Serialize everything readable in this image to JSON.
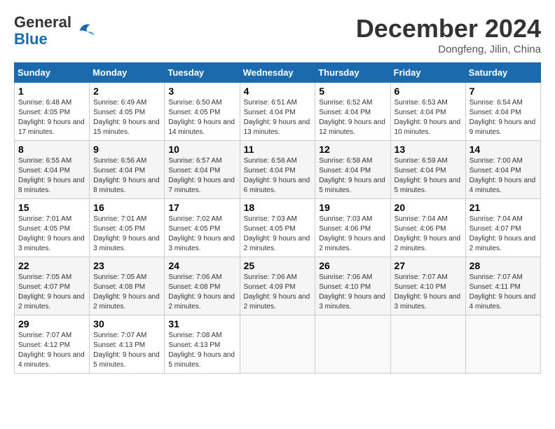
{
  "header": {
    "logo_general": "General",
    "logo_blue": "Blue",
    "month_title": "December 2024",
    "location": "Dongfeng, Jilin, China"
  },
  "days_of_week": [
    "Sunday",
    "Monday",
    "Tuesday",
    "Wednesday",
    "Thursday",
    "Friday",
    "Saturday"
  ],
  "weeks": [
    [
      {
        "day": "1",
        "sunrise": "6:48 AM",
        "sunset": "4:05 PM",
        "daylight": "9 hours and 17 minutes."
      },
      {
        "day": "2",
        "sunrise": "6:49 AM",
        "sunset": "4:05 PM",
        "daylight": "9 hours and 15 minutes."
      },
      {
        "day": "3",
        "sunrise": "6:50 AM",
        "sunset": "4:05 PM",
        "daylight": "9 hours and 14 minutes."
      },
      {
        "day": "4",
        "sunrise": "6:51 AM",
        "sunset": "4:04 PM",
        "daylight": "9 hours and 13 minutes."
      },
      {
        "day": "5",
        "sunrise": "6:52 AM",
        "sunset": "4:04 PM",
        "daylight": "9 hours and 12 minutes."
      },
      {
        "day": "6",
        "sunrise": "6:53 AM",
        "sunset": "4:04 PM",
        "daylight": "9 hours and 10 minutes."
      },
      {
        "day": "7",
        "sunrise": "6:54 AM",
        "sunset": "4:04 PM",
        "daylight": "9 hours and 9 minutes."
      }
    ],
    [
      {
        "day": "8",
        "sunrise": "6:55 AM",
        "sunset": "4:04 PM",
        "daylight": "9 hours and 8 minutes."
      },
      {
        "day": "9",
        "sunrise": "6:56 AM",
        "sunset": "4:04 PM",
        "daylight": "9 hours and 8 minutes."
      },
      {
        "day": "10",
        "sunrise": "6:57 AM",
        "sunset": "4:04 PM",
        "daylight": "9 hours and 7 minutes."
      },
      {
        "day": "11",
        "sunrise": "6:58 AM",
        "sunset": "4:04 PM",
        "daylight": "9 hours and 6 minutes."
      },
      {
        "day": "12",
        "sunrise": "6:58 AM",
        "sunset": "4:04 PM",
        "daylight": "9 hours and 5 minutes."
      },
      {
        "day": "13",
        "sunrise": "6:59 AM",
        "sunset": "4:04 PM",
        "daylight": "9 hours and 5 minutes."
      },
      {
        "day": "14",
        "sunrise": "7:00 AM",
        "sunset": "4:04 PM",
        "daylight": "9 hours and 4 minutes."
      }
    ],
    [
      {
        "day": "15",
        "sunrise": "7:01 AM",
        "sunset": "4:05 PM",
        "daylight": "9 hours and 3 minutes."
      },
      {
        "day": "16",
        "sunrise": "7:01 AM",
        "sunset": "4:05 PM",
        "daylight": "9 hours and 3 minutes."
      },
      {
        "day": "17",
        "sunrise": "7:02 AM",
        "sunset": "4:05 PM",
        "daylight": "9 hours and 3 minutes."
      },
      {
        "day": "18",
        "sunrise": "7:03 AM",
        "sunset": "4:05 PM",
        "daylight": "9 hours and 2 minutes."
      },
      {
        "day": "19",
        "sunrise": "7:03 AM",
        "sunset": "4:06 PM",
        "daylight": "9 hours and 2 minutes."
      },
      {
        "day": "20",
        "sunrise": "7:04 AM",
        "sunset": "4:06 PM",
        "daylight": "9 hours and 2 minutes."
      },
      {
        "day": "21",
        "sunrise": "7:04 AM",
        "sunset": "4:07 PM",
        "daylight": "9 hours and 2 minutes."
      }
    ],
    [
      {
        "day": "22",
        "sunrise": "7:05 AM",
        "sunset": "4:07 PM",
        "daylight": "9 hours and 2 minutes."
      },
      {
        "day": "23",
        "sunrise": "7:05 AM",
        "sunset": "4:08 PM",
        "daylight": "9 hours and 2 minutes."
      },
      {
        "day": "24",
        "sunrise": "7:06 AM",
        "sunset": "4:08 PM",
        "daylight": "9 hours and 2 minutes."
      },
      {
        "day": "25",
        "sunrise": "7:06 AM",
        "sunset": "4:09 PM",
        "daylight": "9 hours and 2 minutes."
      },
      {
        "day": "26",
        "sunrise": "7:06 AM",
        "sunset": "4:10 PM",
        "daylight": "9 hours and 3 minutes."
      },
      {
        "day": "27",
        "sunrise": "7:07 AM",
        "sunset": "4:10 PM",
        "daylight": "9 hours and 3 minutes."
      },
      {
        "day": "28",
        "sunrise": "7:07 AM",
        "sunset": "4:11 PM",
        "daylight": "9 hours and 4 minutes."
      }
    ],
    [
      {
        "day": "29",
        "sunrise": "7:07 AM",
        "sunset": "4:12 PM",
        "daylight": "9 hours and 4 minutes."
      },
      {
        "day": "30",
        "sunrise": "7:07 AM",
        "sunset": "4:13 PM",
        "daylight": "9 hours and 5 minutes."
      },
      {
        "day": "31",
        "sunrise": "7:08 AM",
        "sunset": "4:13 PM",
        "daylight": "9 hours and 5 minutes."
      },
      null,
      null,
      null,
      null
    ]
  ]
}
